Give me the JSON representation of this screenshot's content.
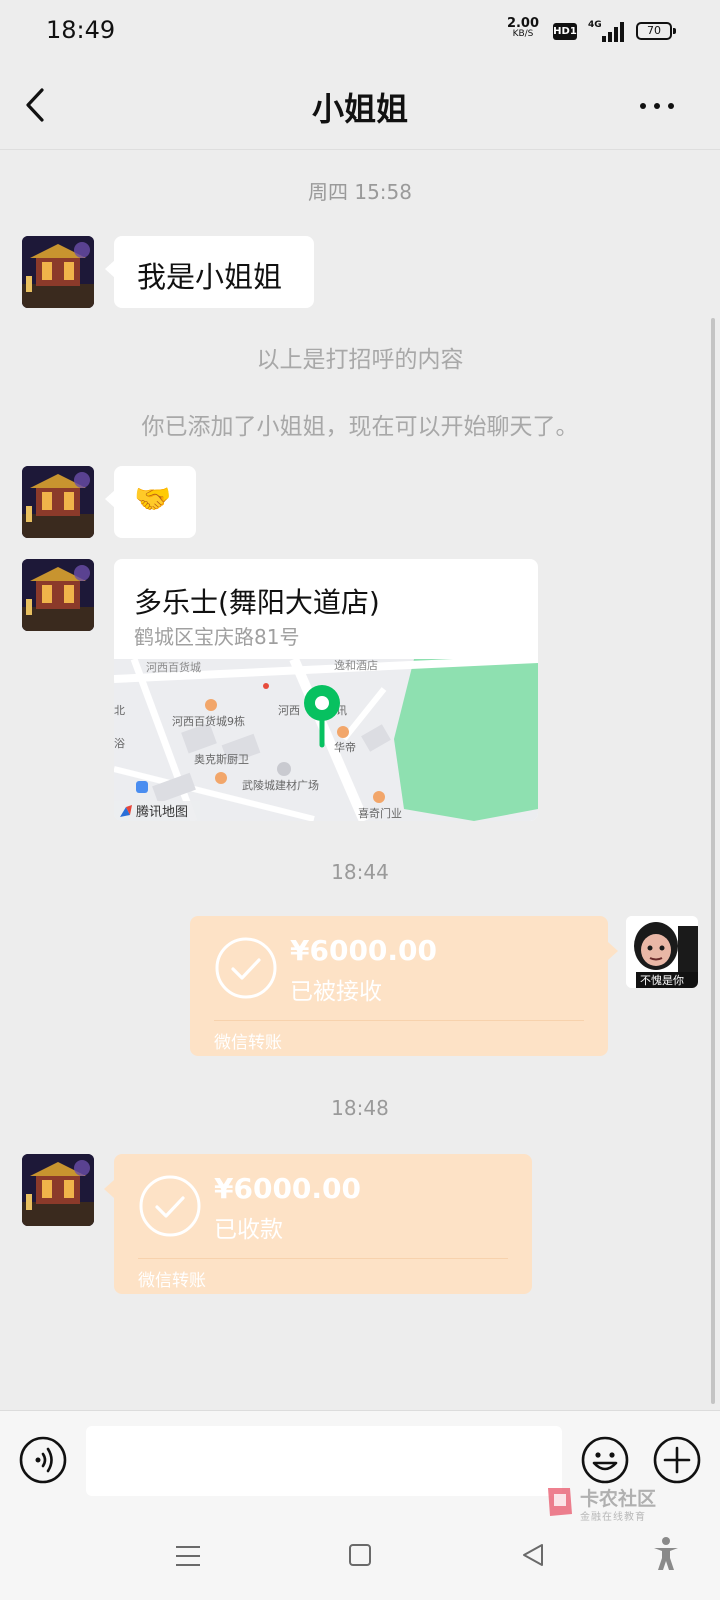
{
  "status_bar": {
    "time": "18:49",
    "net_speed_value": "2.00",
    "net_speed_unit": "KB/S",
    "hd_badge": "HD1",
    "network_type": "4G",
    "battery": "70"
  },
  "header": {
    "title": "小姐姐",
    "back_icon": "chevron-left-icon",
    "more_icon": "more-dots-icon"
  },
  "messages": {
    "time_1": "周四 15:58",
    "greeting_text": "我是小姐姐",
    "sys_1": "以上是打招呼的内容",
    "sys_2": "你已添加了小姐姐，现在可以开始聊天了。",
    "handshake_emoji": "🤝",
    "location": {
      "name": "多乐士(舞阳大道店)",
      "address": "鹤城区宝庆路81号",
      "map_labels": {
        "l1": "河西百货城",
        "l2": "逸和酒店",
        "l3": "河西百货城9栋",
        "l4": "河西",
        "l5": "讯",
        "l6": "华帝",
        "l7": "奥克斯厨卫",
        "l8": "武陵城建材广场",
        "l9": "腾讯地图",
        "l10": "喜奇门业",
        "l11": "浴",
        "l12": "北"
      }
    },
    "time_2": "18:44",
    "transfer_sent": {
      "amount": "¥6000.00",
      "status": "已被接收",
      "source": "微信转账"
    },
    "my_avatar_caption": "不愧是你",
    "time_3": "18:48",
    "transfer_received": {
      "amount": "¥6000.00",
      "status": "已收款",
      "source": "微信转账"
    }
  },
  "input_bar": {
    "voice_icon": "voice-icon",
    "emoji_icon": "emoji-icon",
    "plus_icon": "plus-icon"
  },
  "watermark": {
    "title": "卡农社区",
    "subtitle": "金融在线教育"
  },
  "colors": {
    "background": "#ededed",
    "transfer_bg": "#fde2c6",
    "bubble_bg": "#ffffff",
    "map_pin": "#07c160"
  }
}
